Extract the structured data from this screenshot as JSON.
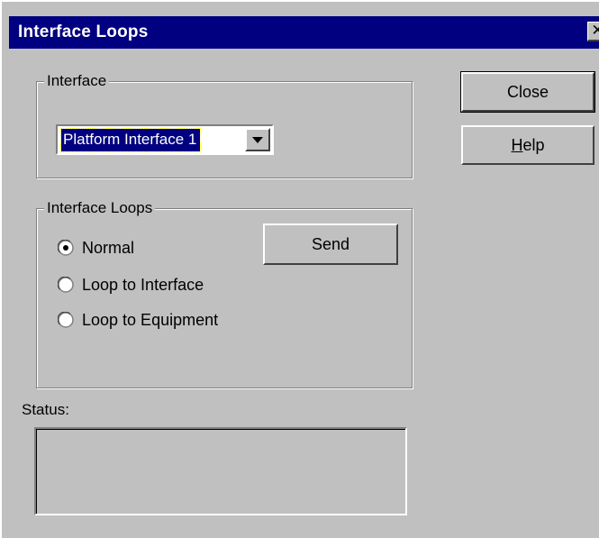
{
  "window": {
    "title": "Interface Loops",
    "close_glyph": "✕"
  },
  "interface_group": {
    "legend": "Interface",
    "selected_value": "Platform Interface 1",
    "dropdown_icon": "triangle-down"
  },
  "loops_group": {
    "legend": "Interface Loops",
    "options": [
      {
        "label": "Normal",
        "checked": true
      },
      {
        "label": "Loop to Interface",
        "checked": false
      },
      {
        "label": "Loop to Equipment",
        "checked": false
      }
    ],
    "send_label": "Send"
  },
  "buttons": {
    "close_label": "Close",
    "help_mnemonic": "H",
    "help_rest": "elp"
  },
  "status": {
    "label": "Status:",
    "value": ""
  },
  "colors": {
    "face": "#c0c0c0",
    "titlebar": "#000080",
    "selection": "#000080"
  }
}
